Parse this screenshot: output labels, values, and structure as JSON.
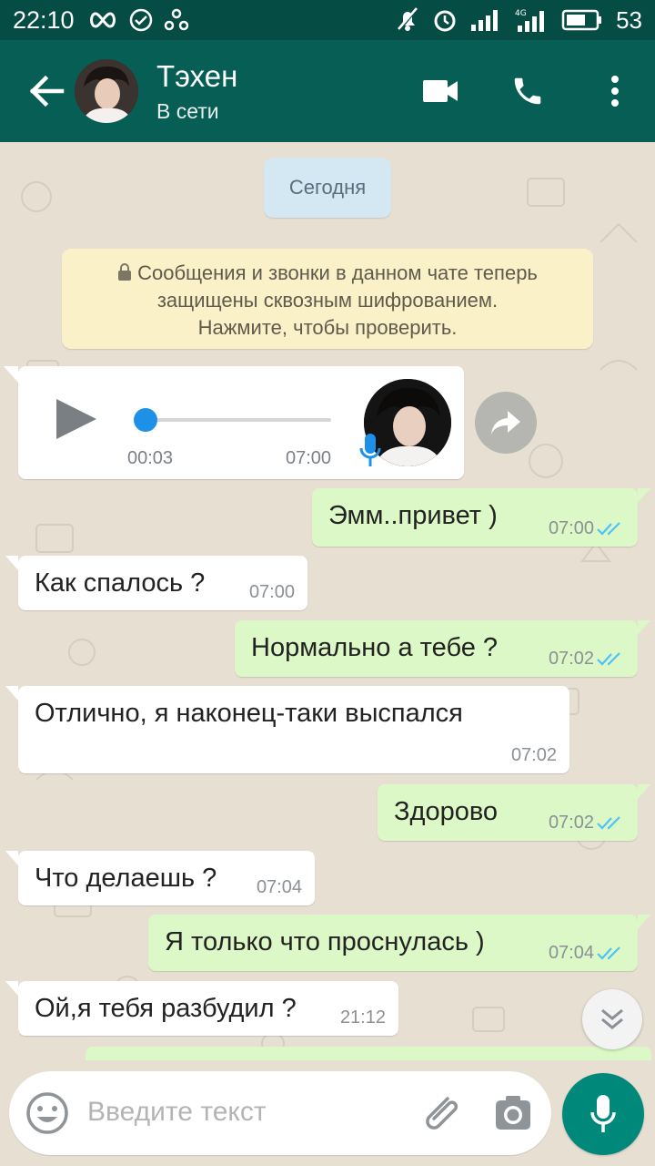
{
  "status_bar": {
    "time": "22:10",
    "battery": "53",
    "network": "4G"
  },
  "header": {
    "contact_name": "Тэхен",
    "status": "В сети"
  },
  "chat": {
    "date_chip": "Сегодня",
    "encryption_notice": {
      "line1": "Сообщения и звонки в данном чате теперь",
      "line2": "защищены сквозным шифрованием.",
      "line3": "Нажмите, чтобы проверить."
    },
    "voice_message": {
      "elapsed": "00:03",
      "time": "07:00",
      "progress": 0.03
    },
    "messages": [
      {
        "direction": "out",
        "text": "Эмм..привет )",
        "time": "07:00",
        "read": true
      },
      {
        "direction": "in",
        "text": "Как спалось ?",
        "time": "07:00"
      },
      {
        "direction": "out",
        "text": "Нормально а тебе ?",
        "time": "07:02",
        "read": true
      },
      {
        "direction": "in",
        "text": "Отлично, я наконец-таки выспался",
        "time": "07:02"
      },
      {
        "direction": "out",
        "text": "Здорово",
        "time": "07:02",
        "read": true
      },
      {
        "direction": "in",
        "text": "Что делаешь ?",
        "time": "07:04"
      },
      {
        "direction": "out",
        "text": "Я только что проснулась )",
        "time": "07:04",
        "read": true
      },
      {
        "direction": "in",
        "text": "Ой,я тебя разбудил ?",
        "time": "21:12"
      }
    ]
  },
  "input": {
    "placeholder": "Введите текст"
  },
  "colors": {
    "header": "#075e54",
    "status_bar": "#054d44",
    "outgoing_bubble": "#dcf8c6",
    "incoming_bubble": "#ffffff",
    "read_ticks": "#4fc3f7",
    "accent": "#00897b"
  },
  "icons": {
    "back": "arrow-left-icon",
    "video": "video-camera-icon",
    "call": "phone-icon",
    "menu": "more-vertical-icon",
    "play": "play-icon",
    "forward": "forward-icon",
    "emoji": "emoji-icon",
    "attach": "paperclip-icon",
    "camera": "camera-icon",
    "mic": "microphone-icon"
  }
}
